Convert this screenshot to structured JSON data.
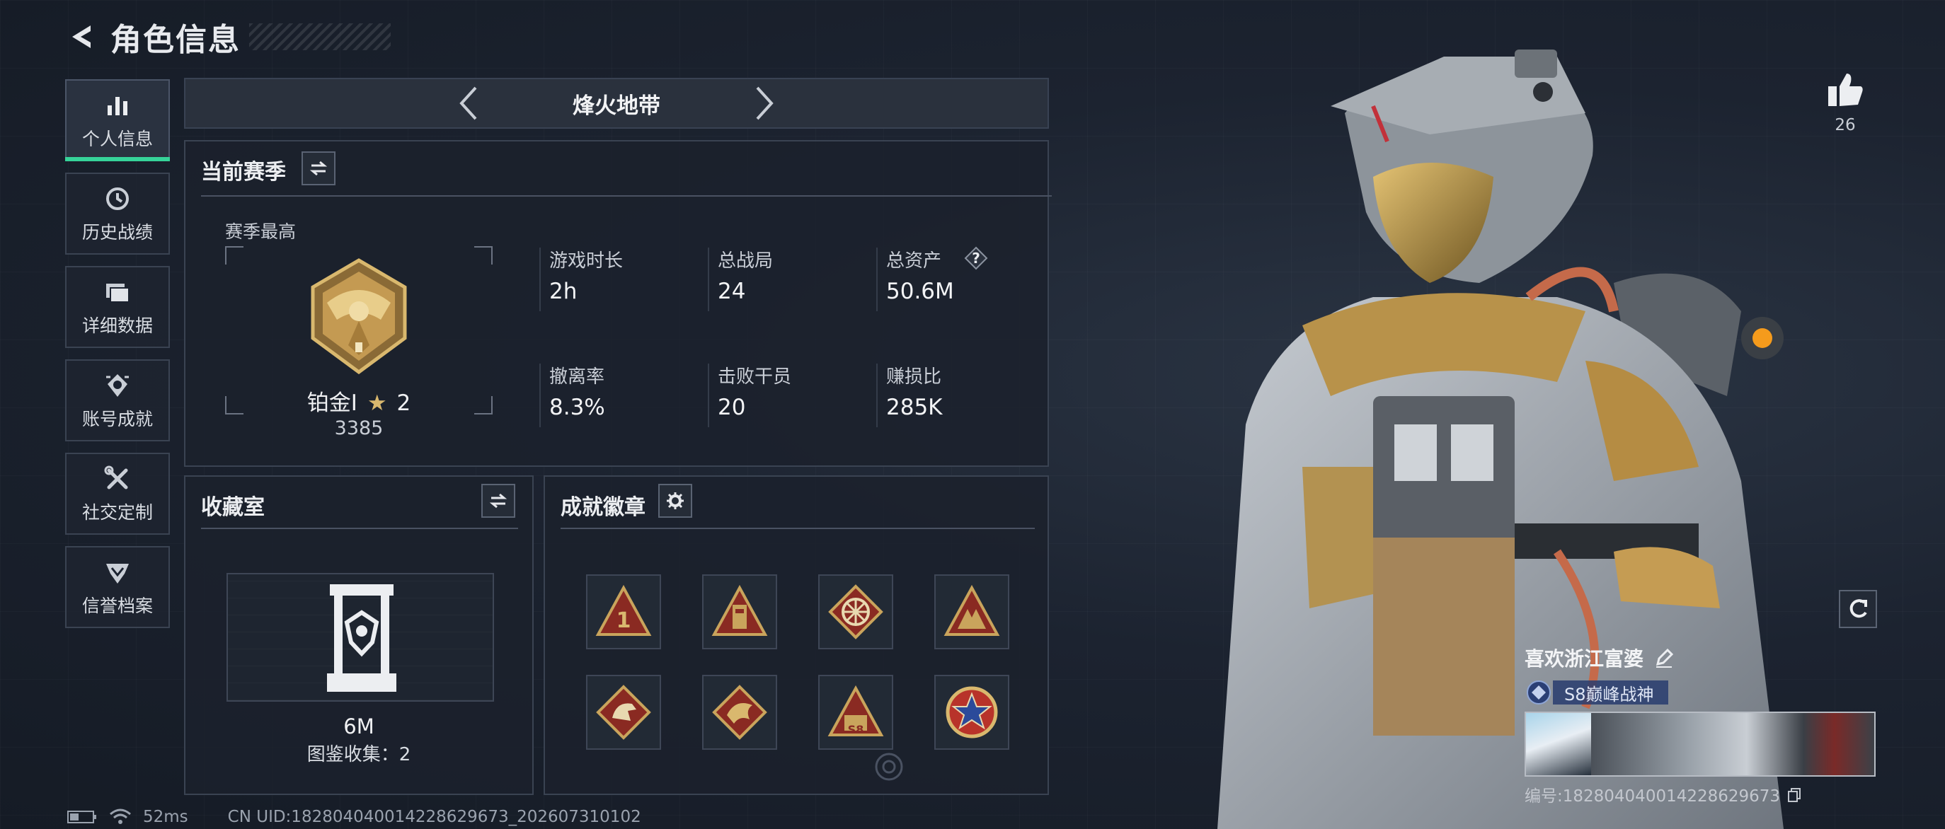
{
  "header": {
    "title": "角色信息"
  },
  "sidebar": {
    "items": [
      {
        "label": "个人信息",
        "icon": "bar-chart-icon",
        "active": true
      },
      {
        "label": "历史战绩",
        "icon": "clock-icon",
        "active": false
      },
      {
        "label": "详细数据",
        "icon": "folder-icon",
        "active": false
      },
      {
        "label": "账号成就",
        "icon": "achievement-icon",
        "active": false
      },
      {
        "label": "社交定制",
        "icon": "tools-icon",
        "active": false
      },
      {
        "label": "信誉档案",
        "icon": "shield-icon",
        "active": false
      }
    ]
  },
  "season_bar": {
    "name": "烽火地带"
  },
  "current_season": {
    "title": "当前赛季",
    "peak_label": "赛季最高",
    "rank_name": "铂金I",
    "rank_stars": "2",
    "rank_score": "3385",
    "stats": [
      {
        "label": "游戏时长",
        "value": "2h"
      },
      {
        "label": "总战局",
        "value": "24"
      },
      {
        "label": "总资产",
        "value": "50.6M",
        "help": "?"
      },
      {
        "label": "撤离率",
        "value": "8.3%"
      },
      {
        "label": "击败干员",
        "value": "20"
      },
      {
        "label": "赚损比",
        "value": "285K"
      }
    ]
  },
  "collection": {
    "title": "收藏室",
    "value": "6M",
    "count_text": "图鉴收集：2"
  },
  "badges": {
    "title": "成就徽章",
    "items": [
      "badge-1",
      "badge-2",
      "badge-3",
      "badge-4",
      "badge-5",
      "badge-6",
      "badge-7",
      "badge-8"
    ],
    "badge7_text": "S8"
  },
  "likes": {
    "count": "26"
  },
  "player": {
    "name": "喜欢浙江富婆",
    "title": "S8巅峰战神",
    "id_text": "编号:182804040014228629673"
  },
  "footer": {
    "ping": "52ms",
    "uid": "CN UID:182804040014228629673_202607310102"
  },
  "colors": {
    "accent_green": "#36d399",
    "panel_border": "#3a4352",
    "gold": "#c9a45c",
    "badge_red": "#8a2a22"
  }
}
